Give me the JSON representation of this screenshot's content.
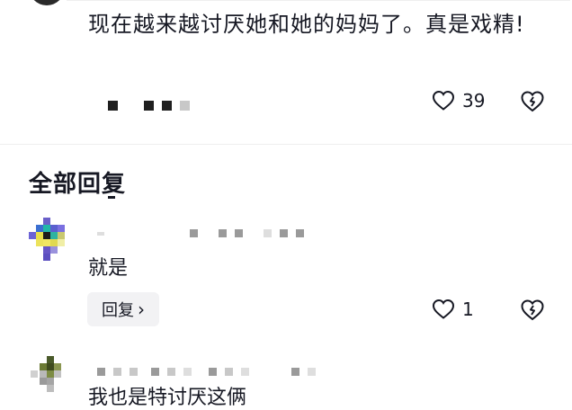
{
  "top_comment": {
    "text": "现在越来越讨厌她和她的妈妈了。真是戏精!",
    "like_count": "39"
  },
  "replies_section": {
    "title": "全部回复"
  },
  "reply": {
    "text": "就是",
    "like_count": "1",
    "reply_button_label": "回复",
    "reply_button_chevron": "›"
  },
  "next_reply": {
    "partial_text": "我也是特讨厌这俩"
  },
  "icons": {
    "like": "heart-outline-icon",
    "dislike": "broken-heart-icon",
    "reply_chevron": "chevron-right-icon"
  },
  "colors": {
    "text": "#161823",
    "button_bg": "#f2f2f4",
    "divider": "#eeeeee"
  }
}
